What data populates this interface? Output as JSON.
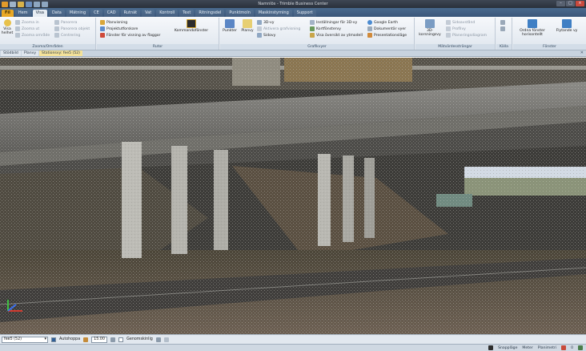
{
  "app": {
    "title": "Namnlös - Trimble Business Center",
    "window_controls": [
      "–",
      "□",
      "×"
    ]
  },
  "ribbon_tabs": [
    "Fil",
    "Hem",
    "Visa",
    "Data",
    "Mätning",
    "CE",
    "CAD",
    "Rutnät",
    "Vat",
    "Kontroll",
    "Text",
    "Ritningsdel",
    "Punktmoln",
    "Maskinstyrning",
    "Support"
  ],
  "active_tab": "Visa",
  "ribbon": {
    "zoom_group": {
      "label": "Zooma/Områden",
      "big_button": "Visa helhet",
      "items": [
        "Zooma in",
        "Zooma ut",
        "Zooma område",
        "Panorera",
        "Panorera objekt",
        "Centrering"
      ]
    },
    "window_group": {
      "label": "Rutor",
      "items": [
        "Planvisning",
        "Projektutforskare",
        "Fönster för visning av flaggor"
      ],
      "big_button": "Kommandofönster"
    },
    "graphics_group": {
      "label": "Grafikvyer",
      "big_buttons": [
        "Punkter",
        "Planvy"
      ],
      "items": [
        "3D-vy",
        "Aktivera grafvisning",
        "Sidovy",
        "Inställningar för 3D-vy",
        "Kortfönstervy",
        "Visa översikt av ytmodell",
        "Google Earth",
        "Dokumentär vyer",
        "Presentationsläge"
      ]
    },
    "measure_group": {
      "label": "Mätvärdessträngar",
      "big_button": "3D-korsningsvy",
      "items": [
        "Sidoavstånd",
        "Profilvy",
        "Planeringsdiagram"
      ]
    },
    "select_group": {
      "label": "Källa"
    },
    "window_arrange_group": {
      "label": "Fönster",
      "big_buttons": [
        "Ordna fönster horisontellt",
        "Flytande vy"
      ]
    }
  },
  "doc_tabs": [
    "Stödbild",
    "Planvy",
    "Stationsvy: fee5 (52)"
  ],
  "active_doc_tab": "Stationsvy: fee5 (52)",
  "bottom": {
    "station_select": "fee5 (52)",
    "auto_next_label": "Autohoppa",
    "auto_next_checked": true,
    "opacity_value": "15.00",
    "transparent_label": "Genomskinlig",
    "transparent_checked": false
  },
  "status": {
    "snap": "Snappläge",
    "units": "Meter",
    "units_extra": "Planimetri",
    "count": "0"
  },
  "colors": {
    "ribbon_tab_bg": "#3a5679",
    "file_tab": "#e9a825",
    "active_doc_tab": "#f4e29a",
    "viewport_bg": "#3a3a38"
  }
}
